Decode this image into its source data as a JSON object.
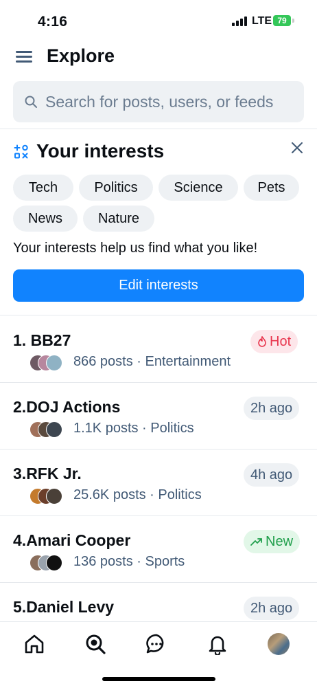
{
  "status_bar": {
    "time": "4:16",
    "network": "LTE",
    "battery": "79"
  },
  "header": {
    "title": "Explore",
    "menu_icon": "hamburger-menu-icon"
  },
  "search": {
    "placeholder": "Search for posts, users, or feeds",
    "icon": "search-icon"
  },
  "interests": {
    "title": "Your interests",
    "chips": [
      "Tech",
      "Politics",
      "Science",
      "Pets",
      "News",
      "Nature"
    ],
    "description": "Your interests help us find what you like!",
    "edit_button": "Edit interests"
  },
  "trending": [
    {
      "rank": "1.",
      "name": "BB27",
      "meta": "866 posts · Entertainment",
      "badge": "Hot",
      "badge_type": "hot"
    },
    {
      "rank": "2.",
      "name": "DOJ Actions",
      "meta": "1.1K posts · Politics",
      "badge": "2h ago",
      "badge_type": "time"
    },
    {
      "rank": "3.",
      "name": "RFK Jr.",
      "meta": "25.6K posts · Politics",
      "badge": "4h ago",
      "badge_type": "time"
    },
    {
      "rank": "4.",
      "name": "Amari Cooper",
      "meta": "136 posts · Sports",
      "badge": "New",
      "badge_type": "new"
    },
    {
      "rank": "5.",
      "name": "Daniel Levy",
      "meta": "",
      "badge": "2h ago",
      "badge_type": "time"
    }
  ],
  "tab_bar": [
    "home-icon",
    "search-icon",
    "chat-icon",
    "notifications-bell-icon",
    "profile-avatar"
  ],
  "colors": {
    "accent": "#1183fe",
    "hot": "#e8364e",
    "new": "#1f9e4b",
    "muted": "#425a76",
    "battery": "#34c759"
  }
}
